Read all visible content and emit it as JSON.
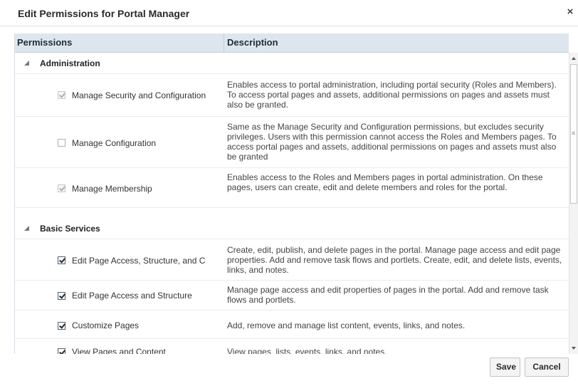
{
  "dialog": {
    "title": "Edit Permissions for Portal Manager",
    "close_label": "×"
  },
  "table": {
    "headers": {
      "permissions": "Permissions",
      "description": "Description"
    },
    "groups": [
      {
        "label": "Administration",
        "rows": [
          {
            "label": "Manage Security and Configuration",
            "state": "disabled-checked",
            "description": "Enables access to portal administration, including portal security (Roles and Members). To access portal pages and assets, additional permissions on pages and assets must also be granted."
          },
          {
            "label": "Manage Configuration",
            "state": "unchecked",
            "description": "Same as the Manage Security and Configuration permissions, but excludes security privileges. Users with this permission cannot access the Roles and Members pages. To access portal pages and assets, additional permissions on pages and assets must also be granted"
          },
          {
            "label": "Manage Membership",
            "state": "disabled-checked",
            "description": "Enables access to the Roles and Members pages in portal administration. On these pages, users can create, edit and delete members and roles for the portal."
          }
        ]
      },
      {
        "label": "Basic Services",
        "rows": [
          {
            "label": "Edit Page Access, Structure, and C",
            "state": "checked",
            "description": "Create, edit, publish, and delete pages in the portal. Manage page access and edit page properties. Add and remove task flows and portlets. Create, edit, and delete lists, events, links, and notes."
          },
          {
            "label": "Edit Page Access and Structure",
            "state": "checked",
            "description": "Manage page access and edit properties of pages in the portal. Add and remove task flows and portlets."
          },
          {
            "label": "Customize Pages",
            "state": "checked",
            "description": "Add, remove and manage list content, events, links, and notes."
          },
          {
            "label": "View Pages and Content",
            "state": "checked",
            "description": "View pages, lists, events, links, and notes."
          }
        ]
      }
    ]
  },
  "buttons": {
    "save": "Save",
    "cancel": "Cancel"
  },
  "icons": {
    "close": "close-icon",
    "collapse": "triangle-collapse-icon",
    "checkbox": "checkbox-icon"
  }
}
